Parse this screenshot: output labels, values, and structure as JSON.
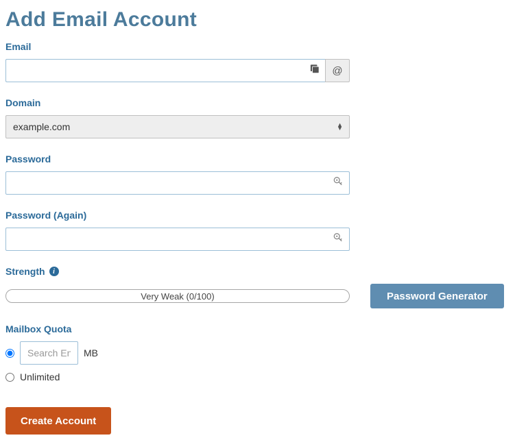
{
  "title": "Add Email Account",
  "labels": {
    "email": "Email",
    "domain": "Domain",
    "password": "Password",
    "password_again": "Password (Again)",
    "strength": "Strength",
    "mailbox_quota": "Mailbox Quota"
  },
  "email": {
    "value": "",
    "at_symbol": "@"
  },
  "domain": {
    "selected": "example.com",
    "options": [
      "example.com"
    ]
  },
  "password": {
    "value": ""
  },
  "password_again": {
    "value": ""
  },
  "strength": {
    "text": "Very Weak (0/100)",
    "score": 0,
    "max": 100
  },
  "quota": {
    "mode": "custom",
    "custom_placeholder": "Search Engine",
    "unit": "MB",
    "unlimited_label": "Unlimited"
  },
  "buttons": {
    "password_generator": "Password Generator",
    "create_account": "Create Account"
  }
}
